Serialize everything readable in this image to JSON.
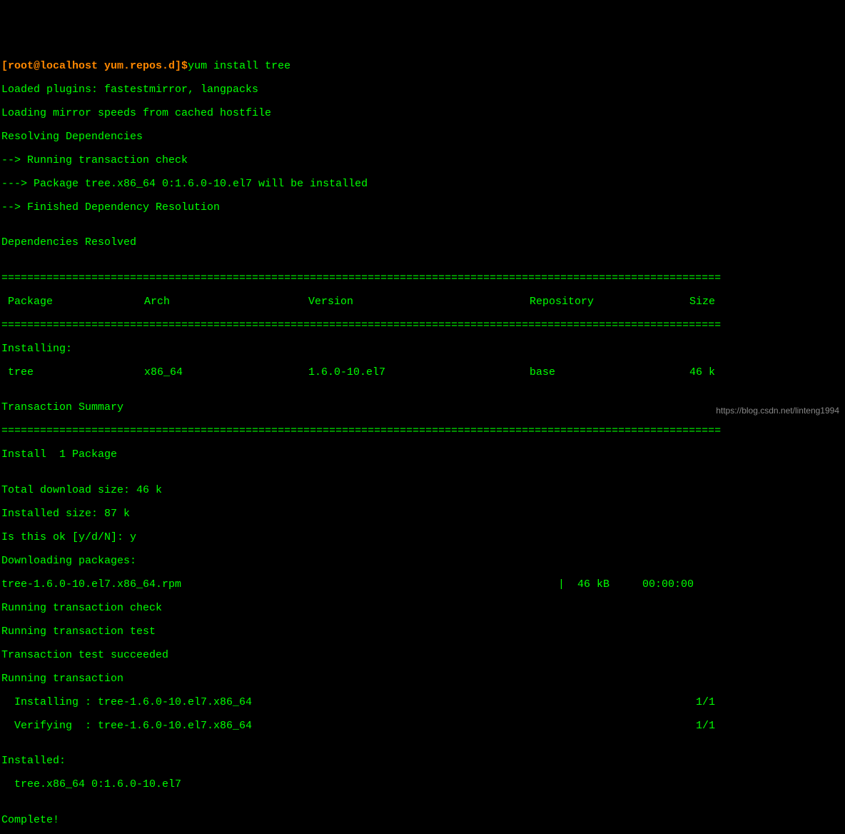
{
  "prompt": {
    "user": "[root@localhost yum.repos.d]",
    "dollar": "$",
    "command": "yum install tree"
  },
  "output": {
    "l1": "Loaded plugins: fastestmirror, langpacks",
    "l2": "Loading mirror speeds from cached hostfile",
    "l3": "Resolving Dependencies",
    "l4": "--> Running transaction check",
    "l5": "---> Package tree.x86_64 0:1.6.0-10.el7 will be installed",
    "l6": "--> Finished Dependency Resolution",
    "l7": "",
    "l8": "Dependencies Resolved",
    "l9": ""
  },
  "sep": "================================================================================================================",
  "headers": {
    "pkg": " Package",
    "arch": "Arch",
    "ver": "Version",
    "repo": "Repository",
    "size": " Size"
  },
  "install_header": "Installing:",
  "pkg_row": {
    "pkg": " tree",
    "arch": "x86_64",
    "ver": "1.6.0-10.el7",
    "repo": "base",
    "size": " 46 k"
  },
  "blank": "",
  "trans_summary": "Transaction Summary",
  "install_count": "Install  1 Package",
  "download": {
    "l1": "Total download size: 46 k",
    "l2": "Installed size: 87 k",
    "l3": "Is this ok [y/d/N]: y",
    "l4": "Downloading packages:"
  },
  "progress": {
    "left": "tree-1.6.0-10.el7.x86_64.rpm",
    "mid": "|  46 kB",
    "right": "  00:00:00"
  },
  "trans": {
    "l1": "Running transaction check",
    "l2": "Running transaction test",
    "l3": "Transaction test succeeded",
    "l4": "Running transaction"
  },
  "install_line": {
    "left": "  Installing : tree-1.6.0-10.el7.x86_64",
    "right": "1/1"
  },
  "verify_line": {
    "left": "  Verifying  : tree-1.6.0-10.el7.x86_64",
    "right": "1/1"
  },
  "installed": {
    "l1": "Installed:",
    "l2": "  tree.x86_64 0:1.6.0-10.el7"
  },
  "complete": "Complete!",
  "watermark": "https://blog.csdn.net/linteng1994"
}
